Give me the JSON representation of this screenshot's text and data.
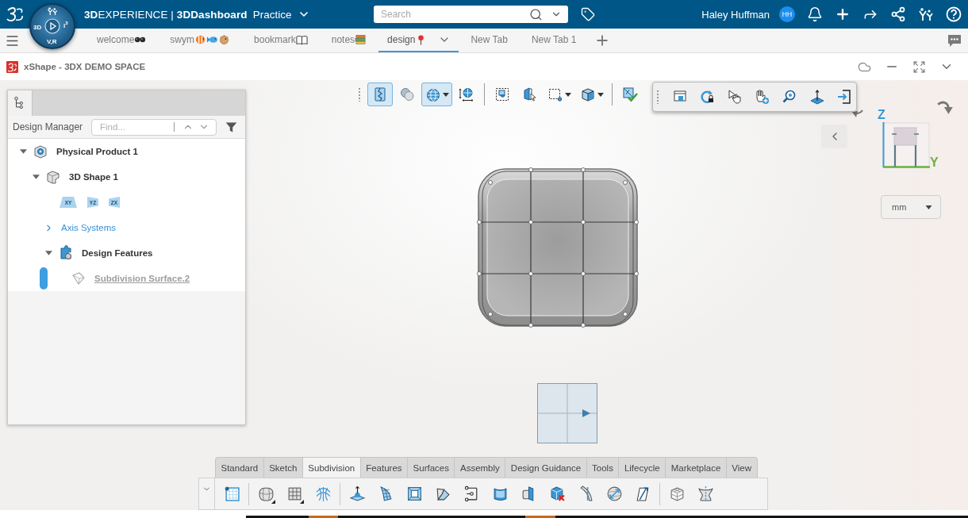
{
  "top_bar": {
    "title": "**3D**EXPERIENCE | **3DDashboard**",
    "space": "Practice",
    "search": {
      "placeholder": "Search"
    },
    "user": {
      "name": "Haley Huffman",
      "initials": "HH"
    }
  },
  "compass": {
    "west": "3D",
    "east": "i$^{3}$",
    "south": "V,R"
  },
  "tabs": [
    {
      "label": "welcome",
      "icons": [
        {
          "kind": "glasses"
        }
      ],
      "selected": false
    },
    {
      "label": "swym",
      "icons": [
        {
          "kind": "tropical-fish"
        },
        {
          "kind": "fish"
        },
        {
          "kind": "blowfish"
        }
      ],
      "selected": false
    },
    {
      "label": "bookmark",
      "icons": [
        {
          "kind": "book"
        }
      ],
      "selected": false
    },
    {
      "label": "notes",
      "icons": [
        {
          "kind": "books"
        }
      ],
      "selected": false
    },
    {
      "label": "design",
      "icons": [
        {
          "kind": "pushpin"
        }
      ],
      "selected": true
    },
    {
      "label": "New Tab",
      "selected": false
    },
    {
      "label": "New Tab 1",
      "selected": false
    }
  ],
  "app_header": {
    "title": "xShape - 3DX DEMO SPACE"
  },
  "design_manager": {
    "tabs": [
      {
        "kind": "tree",
        "selected": true
      }
    ],
    "label": "Design Manager",
    "find": {
      "placeholder": "Find..."
    },
    "tree": [
      {
        "kind": "product",
        "label": "Physical Product 1",
        "expanded": true,
        "current": false,
        "hidden": false,
        "children": [
          {
            "kind": "shape",
            "label": "3D Shape 1",
            "expanded": true,
            "current": false,
            "hidden": false,
            "children": [
              {
                "kind": "planes",
                "planes": [
                  {
                    "label": "XY",
                    "kind": "horizontal"
                  },
                  {
                    "label": "YZ",
                    "kind": "vertical-left"
                  },
                  {
                    "label": "ZX",
                    "kind": "vertical-right"
                  }
                ]
              },
              {
                "kind": "group",
                "label": "Axis Systems",
                "expanded": false,
                "current": false,
                "hidden": false
              },
              {
                "kind": "features",
                "label": "Design Features",
                "expanded": true,
                "current": false,
                "hidden": false,
                "children": [
                  {
                    "kind": "surface",
                    "label": "Subdivision Surface.2",
                    "current": true,
                    "hidden": true
                  }
                ]
              }
            ]
          }
        ]
      }
    ]
  },
  "view_toolbar": {
    "groups": [
      [
        {
          "kind": "section",
          "selected": true,
          "dropdown": false
        },
        {
          "kind": "spheres",
          "selected": false,
          "dropdown": false
        },
        {
          "kind": "globe",
          "selected": true,
          "dropdown": true
        },
        {
          "kind": "measure-globe",
          "selected": false,
          "dropdown": false
        }
      ],
      [
        {
          "kind": "box-select",
          "selected": false,
          "dropdown": false
        },
        {
          "kind": "door-cursor",
          "selected": false,
          "dropdown": false
        },
        {
          "kind": "dashed-select",
          "selected": false,
          "dropdown": true
        },
        {
          "kind": "cube",
          "selected": false,
          "dropdown": true
        }
      ],
      [
        {
          "kind": "check",
          "selected": false,
          "dropdown": false
        }
      ]
    ]
  },
  "floating_toolbar": {
    "tools": [
      {
        "kind": "pin-window"
      },
      {
        "kind": "rotate-lock"
      },
      {
        "kind": "select-cursor"
      },
      {
        "kind": "hand-add"
      },
      {
        "kind": "zoom-search"
      },
      {
        "kind": "axis-plane"
      },
      {
        "kind": "exit"
      }
    ]
  },
  "view_cube": {
    "axes": [
      {
        "label": "Z",
        "color": "#3a9ad9"
      },
      {
        "label": "Y",
        "color": "#6ab23e"
      }
    ]
  },
  "units": {
    "value": "mm"
  },
  "action_bar": {
    "tabs": [
      {
        "label": "Standard",
        "selected": false
      },
      {
        "label": "Sketch",
        "selected": false
      },
      {
        "label": "Subdivision",
        "selected": true
      },
      {
        "label": "Features",
        "selected": false
      },
      {
        "label": "Surfaces",
        "selected": false
      },
      {
        "label": "Assembly",
        "selected": false
      },
      {
        "label": "Design Guidance",
        "selected": false
      },
      {
        "label": "Tools",
        "selected": false
      },
      {
        "label": "Lifecycle",
        "selected": false
      },
      {
        "label": "Marketplace",
        "selected": false
      },
      {
        "label": "View",
        "selected": false
      }
    ],
    "groups": [
      [
        {
          "kind": "sketch-grid",
          "flyout": false
        }
      ],
      [
        {
          "kind": "subd-cube",
          "flyout": true
        },
        {
          "kind": "subd-plane",
          "flyout": true
        },
        {
          "kind": "net",
          "flyout": false
        }
      ],
      [
        {
          "kind": "extrude",
          "flyout": false
        },
        {
          "kind": "curved-mesh",
          "flyout": false
        },
        {
          "kind": "frame",
          "flyout": false
        },
        {
          "kind": "bent",
          "flyout": false
        },
        {
          "kind": "bracket",
          "flyout": false
        },
        {
          "kind": "curved-panel",
          "flyout": false
        },
        {
          "kind": "cube-plane",
          "flyout": false
        },
        {
          "kind": "cube-delete",
          "flyout": false
        },
        {
          "kind": "strip",
          "flyout": false
        },
        {
          "kind": "sphere-arrow",
          "flyout": false
        },
        {
          "kind": "slanted",
          "flyout": false
        }
      ],
      [
        {
          "kind": "cube-split",
          "flyout": false
        },
        {
          "kind": "symmetry",
          "flyout": false
        }
      ]
    ]
  }
}
